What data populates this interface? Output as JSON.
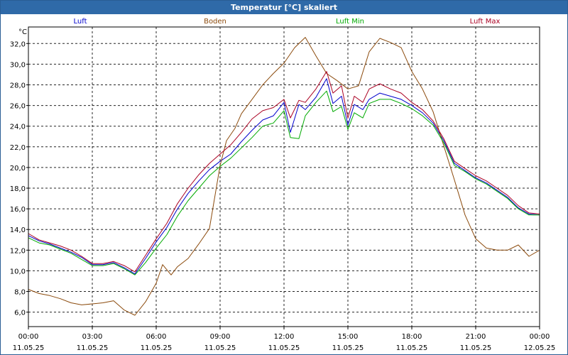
{
  "chart_data": {
    "type": "line",
    "title": "Temperatur [°C] skaliert",
    "ylabel": "°C",
    "ylim": [
      4.6,
      33.6
    ],
    "yticks": [
      "6,0",
      "8,0",
      "10,0",
      "12,0",
      "14,0",
      "16,0",
      "18,0",
      "20,0",
      "22,0",
      "24,0",
      "26,0",
      "28,0",
      "30,0",
      "32,0"
    ],
    "ytick_values": [
      6,
      8,
      10,
      12,
      14,
      16,
      18,
      20,
      22,
      24,
      26,
      28,
      30,
      32
    ],
    "xlim": [
      0,
      24
    ],
    "xticks": [
      {
        "time": "00:00",
        "date": "11.05.25"
      },
      {
        "time": "03:00",
        "date": "11.05.25"
      },
      {
        "time": "06:00",
        "date": "11.05.25"
      },
      {
        "time": "09:00",
        "date": "11.05.25"
      },
      {
        "time": "12:00",
        "date": "11.05.25"
      },
      {
        "time": "15:00",
        "date": "11.05.25"
      },
      {
        "time": "18:00",
        "date": "11.05.25"
      },
      {
        "time": "21:00",
        "date": "11.05.25"
      },
      {
        "time": "00:00",
        "date": "12.05.25"
      }
    ],
    "grid": true,
    "legend_position": "top",
    "series": [
      {
        "name": "Luft",
        "color": "#0000cc",
        "x": [
          0,
          0.5,
          1,
          1.5,
          2,
          2.5,
          3,
          3.5,
          4,
          4.5,
          5,
          5.5,
          6,
          6.5,
          7,
          7.5,
          8,
          8.5,
          9,
          9.5,
          10,
          10.5,
          11,
          11.5,
          12,
          12.3,
          12.7,
          13,
          13.5,
          14,
          14.3,
          14.7,
          15,
          15.3,
          15.7,
          16,
          16.5,
          17,
          17.5,
          18,
          18.5,
          19,
          19.5,
          20,
          20.5,
          21,
          21.5,
          22,
          22.5,
          23,
          23.5,
          24
        ],
        "y": [
          13.4,
          12.9,
          12.6,
          12.2,
          11.8,
          11.3,
          10.6,
          10.6,
          10.8,
          10.3,
          9.7,
          11.2,
          12.8,
          14.2,
          16.0,
          17.5,
          18.7,
          19.8,
          20.6,
          21.3,
          22.5,
          23.6,
          24.6,
          25.0,
          26.3,
          23.4,
          26.1,
          25.6,
          26.8,
          28.6,
          26.2,
          26.9,
          24.1,
          26.1,
          25.6,
          26.6,
          27.2,
          26.9,
          26.6,
          26.0,
          25.3,
          24.3,
          22.6,
          20.4,
          19.7,
          19.0,
          18.5,
          17.8,
          17.1,
          16.1,
          15.5,
          15.4
        ]
      },
      {
        "name": "Boden",
        "color": "#8b4a0c",
        "x": [
          0,
          0.5,
          1,
          1.5,
          2,
          2.5,
          3,
          3.5,
          4,
          4.5,
          5,
          5.5,
          6,
          6.3,
          6.7,
          7,
          7.5,
          8,
          8.5,
          9,
          9.3,
          9.7,
          10,
          10.5,
          11,
          11.5,
          12,
          12.5,
          13,
          13.5,
          14,
          14.5,
          15,
          15.5,
          16,
          16.5,
          17,
          17.5,
          18,
          18.5,
          19,
          19.5,
          20,
          20.5,
          21,
          21.5,
          22,
          22.5,
          23,
          23.5,
          24
        ],
        "y": [
          8.2,
          7.8,
          7.6,
          7.3,
          6.9,
          6.7,
          6.8,
          6.9,
          7.1,
          6.2,
          5.7,
          7.0,
          8.8,
          10.6,
          9.6,
          10.4,
          11.2,
          12.6,
          14.1,
          20.2,
          22.6,
          23.8,
          25.2,
          26.6,
          28.0,
          29.1,
          30.1,
          31.6,
          32.6,
          30.8,
          29.1,
          28.4,
          27.6,
          27.9,
          31.2,
          32.5,
          32.1,
          31.6,
          29.3,
          27.6,
          25.4,
          22.1,
          18.8,
          15.4,
          13.1,
          12.2,
          12.0,
          12.0,
          12.5,
          11.4,
          12.0
        ]
      },
      {
        "name": "Luft Min",
        "color": "#00aa00",
        "x": [
          0,
          0.5,
          1,
          1.5,
          2,
          2.5,
          3,
          3.5,
          4,
          4.5,
          5,
          5.5,
          6,
          6.5,
          7,
          7.5,
          8,
          8.5,
          9,
          9.5,
          10,
          10.5,
          11,
          11.5,
          12,
          12.3,
          12.7,
          13,
          13.5,
          14,
          14.3,
          14.7,
          15,
          15.3,
          15.7,
          16,
          16.5,
          17,
          17.5,
          18,
          18.5,
          19,
          19.5,
          20,
          20.5,
          21,
          21.5,
          22,
          22.5,
          23,
          23.5,
          24
        ],
        "y": [
          13.2,
          12.7,
          12.5,
          12.1,
          11.7,
          11.1,
          10.5,
          10.5,
          10.7,
          10.2,
          9.6,
          10.8,
          12.2,
          13.5,
          15.3,
          16.8,
          18.0,
          19.2,
          20.1,
          20.9,
          21.9,
          22.9,
          24.0,
          24.3,
          25.5,
          22.9,
          22.8,
          25.0,
          26.3,
          27.4,
          25.4,
          25.9,
          23.7,
          25.3,
          24.8,
          26.2,
          26.6,
          26.6,
          26.2,
          25.7,
          25.0,
          24.1,
          22.4,
          20.2,
          19.6,
          18.9,
          18.4,
          17.7,
          17.0,
          16.0,
          15.4,
          15.4
        ]
      },
      {
        "name": "Luft Max",
        "color": "#aa0022",
        "x": [
          0,
          0.5,
          1,
          1.5,
          2,
          2.5,
          3,
          3.5,
          4,
          4.5,
          5,
          5.5,
          6,
          6.5,
          7,
          7.5,
          8,
          8.5,
          9,
          9.5,
          10,
          10.5,
          11,
          11.5,
          12,
          12.3,
          12.7,
          13,
          13.5,
          14,
          14.3,
          14.7,
          15,
          15.3,
          15.7,
          16,
          16.5,
          17,
          17.5,
          18,
          18.5,
          19,
          19.5,
          20,
          20.5,
          21,
          21.5,
          22,
          22.5,
          23,
          23.5,
          24
        ],
        "y": [
          13.6,
          13.0,
          12.7,
          12.4,
          12.0,
          11.4,
          10.7,
          10.7,
          10.9,
          10.5,
          9.9,
          11.5,
          13.1,
          14.6,
          16.5,
          18.0,
          19.3,
          20.4,
          21.3,
          22.2,
          23.4,
          24.7,
          25.5,
          25.8,
          26.6,
          24.8,
          26.5,
          26.3,
          27.6,
          29.3,
          27.2,
          27.9,
          24.8,
          26.9,
          26.3,
          27.6,
          28.1,
          27.6,
          27.2,
          26.3,
          25.6,
          24.5,
          22.8,
          20.6,
          19.9,
          19.2,
          18.7,
          18.0,
          17.3,
          16.3,
          15.6,
          15.5
        ]
      }
    ]
  }
}
